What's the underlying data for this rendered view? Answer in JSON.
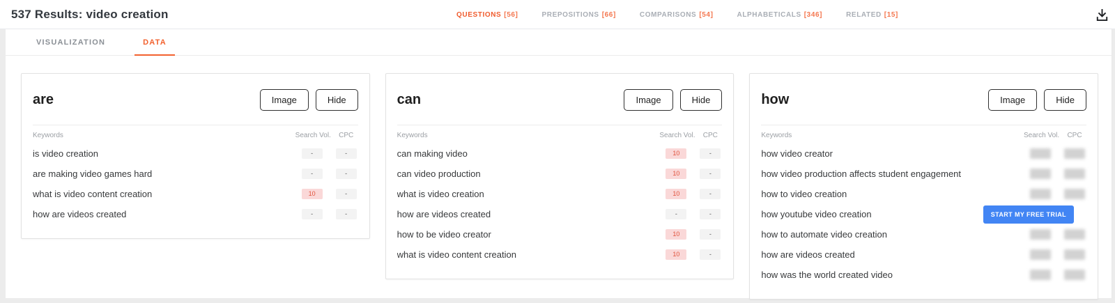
{
  "header": {
    "title": "537 Results: video creation",
    "nav": [
      {
        "id": "questions",
        "label": "QUESTIONS",
        "count": "[56]",
        "active": true
      },
      {
        "id": "prepositions",
        "label": "PREPOSITIONS",
        "count": "[66]",
        "active": false
      },
      {
        "id": "comparisons",
        "label": "COMPARISONS",
        "count": "[54]",
        "active": false
      },
      {
        "id": "alphabeticals",
        "label": "ALPHABETICALS",
        "count": "[346]",
        "active": false
      },
      {
        "id": "related",
        "label": "RELATED",
        "count": "[15]",
        "active": false
      }
    ]
  },
  "tabs": [
    {
      "id": "visualization",
      "label": "VISUALIZATION",
      "active": false
    },
    {
      "id": "data",
      "label": "DATA",
      "active": true
    }
  ],
  "columns": {
    "keywords": "Keywords",
    "search_vol": "Search Vol.",
    "cpc": "CPC"
  },
  "card_buttons": {
    "image": "Image",
    "hide": "Hide"
  },
  "cta": {
    "label": "START MY FREE TRIAL",
    "color": "#4285f4"
  },
  "badge_colors": {
    "pink_bg": "#fad8d8",
    "pink_text": "#e0523c",
    "gray_bg": "#f3f3f3"
  },
  "accent_color": "#f2612e",
  "cards": [
    {
      "title": "are",
      "rows": [
        {
          "keyword": "is video creation",
          "search_vol": "-",
          "vol_style": "gray",
          "cpc": "-"
        },
        {
          "keyword": "are making video games hard",
          "search_vol": "-",
          "vol_style": "gray",
          "cpc": "-"
        },
        {
          "keyword": "what is video content creation",
          "search_vol": "10",
          "vol_style": "pink",
          "cpc": "-"
        },
        {
          "keyword": "how are videos created",
          "search_vol": "-",
          "vol_style": "gray",
          "cpc": "-"
        }
      ]
    },
    {
      "title": "can",
      "rows": [
        {
          "keyword": "can making video",
          "search_vol": "10",
          "vol_style": "pink",
          "cpc": "-"
        },
        {
          "keyword": "can video production",
          "search_vol": "10",
          "vol_style": "pink",
          "cpc": "-"
        },
        {
          "keyword": "what is video creation",
          "search_vol": "10",
          "vol_style": "pink",
          "cpc": "-"
        },
        {
          "keyword": "how are videos created",
          "search_vol": "-",
          "vol_style": "gray",
          "cpc": "-"
        },
        {
          "keyword": "how to be video creator",
          "search_vol": "10",
          "vol_style": "pink",
          "cpc": "-"
        },
        {
          "keyword": "what is video content creation",
          "search_vol": "10",
          "vol_style": "pink",
          "cpc": "-"
        }
      ]
    },
    {
      "title": "how",
      "rows": [
        {
          "keyword": "how video creator",
          "blurred": true
        },
        {
          "keyword": "how video production affects student engagement",
          "blurred": true
        },
        {
          "keyword": "how to video creation",
          "blurred": true
        },
        {
          "keyword": "how youtube video creation",
          "blurred": true,
          "cta": true
        },
        {
          "keyword": "how to automate video creation",
          "blurred": true
        },
        {
          "keyword": "how are videos created",
          "blurred": true
        },
        {
          "keyword": "how was the world created video",
          "blurred": true
        }
      ]
    }
  ]
}
